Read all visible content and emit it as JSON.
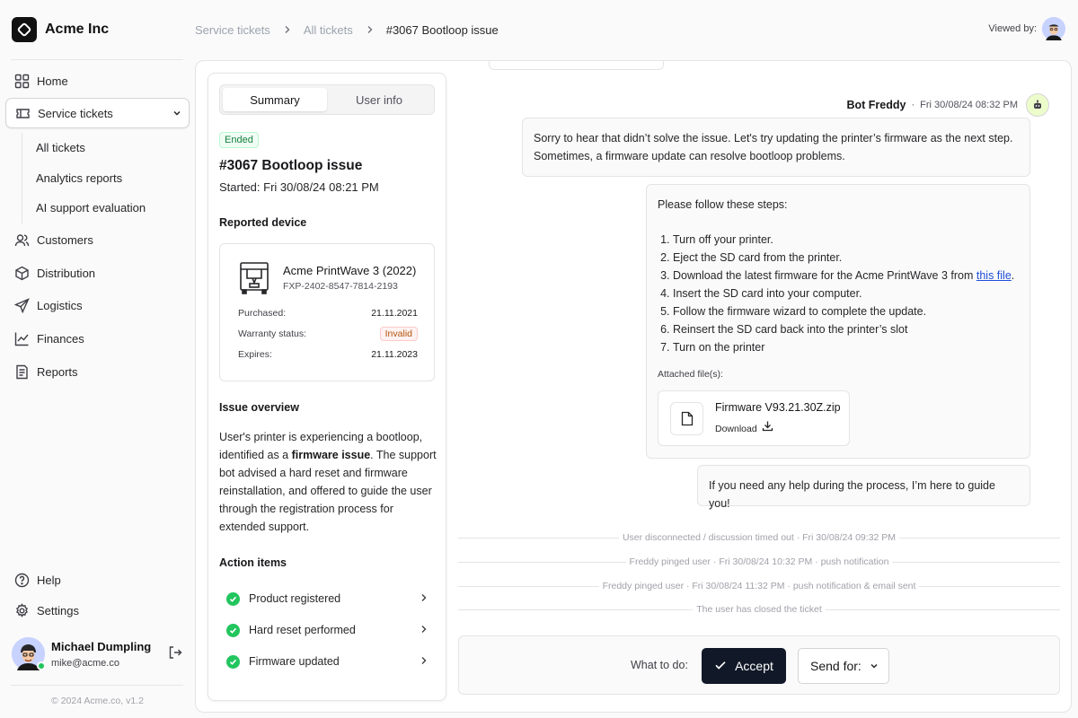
{
  "brand": {
    "name": "Acme Inc"
  },
  "sidebar": {
    "items": [
      {
        "label": "Home",
        "icon": "grid-icon"
      },
      {
        "label": "Service tickets",
        "icon": "ticket-icon"
      },
      {
        "label": "Customers",
        "icon": "users-icon"
      },
      {
        "label": "Distribution",
        "icon": "box-icon"
      },
      {
        "label": "Logistics",
        "icon": "send-icon"
      },
      {
        "label": "Finances",
        "icon": "chart-line-icon"
      },
      {
        "label": "Reports",
        "icon": "report-icon"
      }
    ],
    "subitems": [
      "All tickets",
      "Analytics reports",
      "AI support evaluation"
    ],
    "bottom": [
      {
        "label": "Help",
        "icon": "help-icon"
      },
      {
        "label": "Settings",
        "icon": "gear-icon"
      }
    ]
  },
  "user": {
    "name": "Michael Dumpling",
    "email": "mike@acme.co"
  },
  "copyright": "© 2024 Acme.co, v1.2",
  "breadcrumb": [
    "Service tickets",
    "All tickets",
    "#3067 Bootloop issue"
  ],
  "viewed_by_label": "Viewed by:",
  "panel": {
    "tabs": [
      "Summary",
      "User info"
    ],
    "status": "Ended",
    "title": "#3067 Bootloop issue",
    "started": "Started: Fri 30/08/24 08:21 PM",
    "reported_device_heading": "Reported device",
    "device": {
      "name": "Acme PrintWave 3 (2022)",
      "serial": "FXP-2402-8547-7814-2193",
      "purchased_label": "Purchased:",
      "purchased_value": "21.11.2021",
      "warranty_label": "Warranty status:",
      "warranty_value": "Invalid",
      "expires_label": "Expires:",
      "expires_value": "21.11.2023"
    },
    "issue_heading": "Issue overview",
    "issue_pre": "User's printer is experiencing a bootloop, identified as a ",
    "issue_bold": "firmware issue",
    "issue_post": ". The support bot advised a hard reset and firmware reinstallation, and offered to guide the user through the registration process for extended support.",
    "actions_heading": "Action items",
    "actions": [
      "Product registered",
      "Hard reset performed",
      "Firmware updated"
    ]
  },
  "chat": {
    "bot_name": "Bot Freddy",
    "msg_time": "Fri 30/08/24 08:32 PM",
    "msg1": "Sorry to hear that didn’t solve the issue. Let's try updating the printer’s firmware as the next step. Sometimes, a firmware update can resolve bootloop problems.",
    "msg2_intro": "Please follow these steps:",
    "steps": [
      "Turn off your printer.",
      "Eject the SD card from the printer.",
      "Download the latest firmware for the Acme PrintWave 3 from ",
      "Insert the SD card into your computer.",
      "Follow the firmware wizard to complete the update.",
      "Reinsert the SD card back into the printer’s slot",
      "Turn on the printer"
    ],
    "step3_link": "this file",
    "attached_label": "Attached file(s):",
    "file_name": "Firmware V93.21.30Z.zip",
    "download_label": "Download",
    "msg3": "If you need any help during the process, I’m here to guide you!",
    "events": [
      "User disconnected / discussion timed out  ·  Fri 30/08/24 09:32 PM",
      "Freddy pinged user  ·  Fri 30/08/24 10:32 PM  ·  push notification",
      "Freddy pinged user  ·  Fri 30/08/24 11:32 PM  ·  push notification & email sent",
      "The user has closed the ticket"
    ],
    "what_to_do": "What to do:",
    "accept_label": "Accept",
    "send_for_label": "Send for:"
  }
}
